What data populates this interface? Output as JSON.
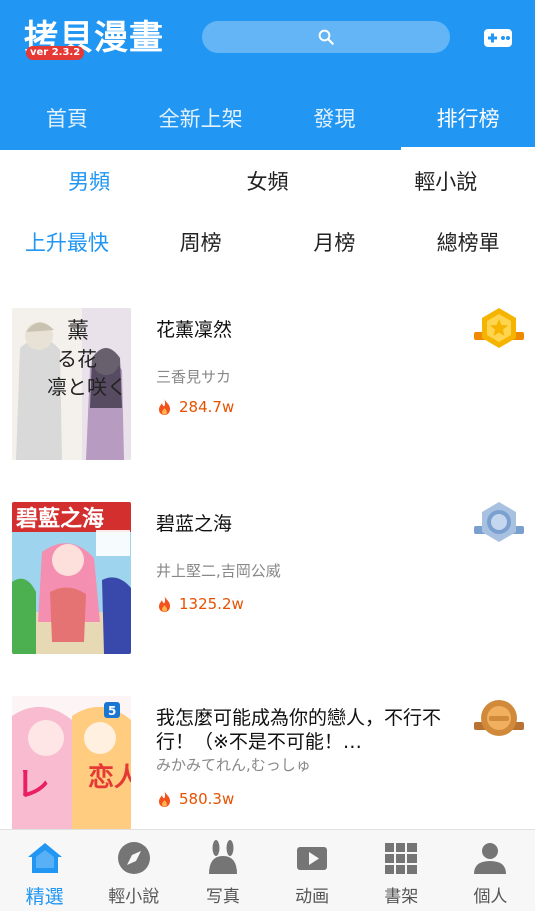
{
  "app": {
    "logo": "拷貝漫畫",
    "version": "ver 2.3.2"
  },
  "colors": {
    "primary": "#2196f3",
    "hot": "#e65100",
    "gold": "#f5b400",
    "silver": "#8fb0d8",
    "bronze": "#d18a3a"
  },
  "top_tabs": [
    "首頁",
    "全新上架",
    "發現",
    "排行榜"
  ],
  "top_tab_active": "排行榜",
  "filters": {
    "category": [
      "男頻",
      "女頻",
      "輕小說"
    ],
    "category_active": "男頻",
    "period": [
      "上升最快",
      "周榜",
      "月榜",
      "總榜單"
    ],
    "period_active": "上升最快"
  },
  "ranking": [
    {
      "title": "花薰凜然",
      "author": "三香見サカ",
      "views": "284.7w",
      "medal": "gold",
      "medal_icon": "gold-medal-icon"
    },
    {
      "title": "碧蓝之海",
      "author": "井上堅二,吉岡公威",
      "views": "1325.2w",
      "medal": "silver",
      "medal_icon": "silver-medal-icon"
    },
    {
      "title": "我怎麼可能成為你的戀人，不行不行！（※不是不可能！…",
      "author": "みかみてれん,むっしゅ",
      "views": "580.3w",
      "medal": "bronze",
      "medal_icon": "bronze-medal-icon"
    }
  ],
  "bottom_nav": [
    "精選",
    "輕小說",
    "写真",
    "动画",
    "書架",
    "個人"
  ],
  "bottom_nav_active": "精選",
  "icons": {
    "search": "search-icon",
    "game": "gamepad-icon",
    "hot": "fire-icon",
    "nav": [
      "home-icon",
      "compass-icon",
      "bunny-icon",
      "video-icon",
      "bookshelf-icon",
      "person-icon"
    ]
  }
}
